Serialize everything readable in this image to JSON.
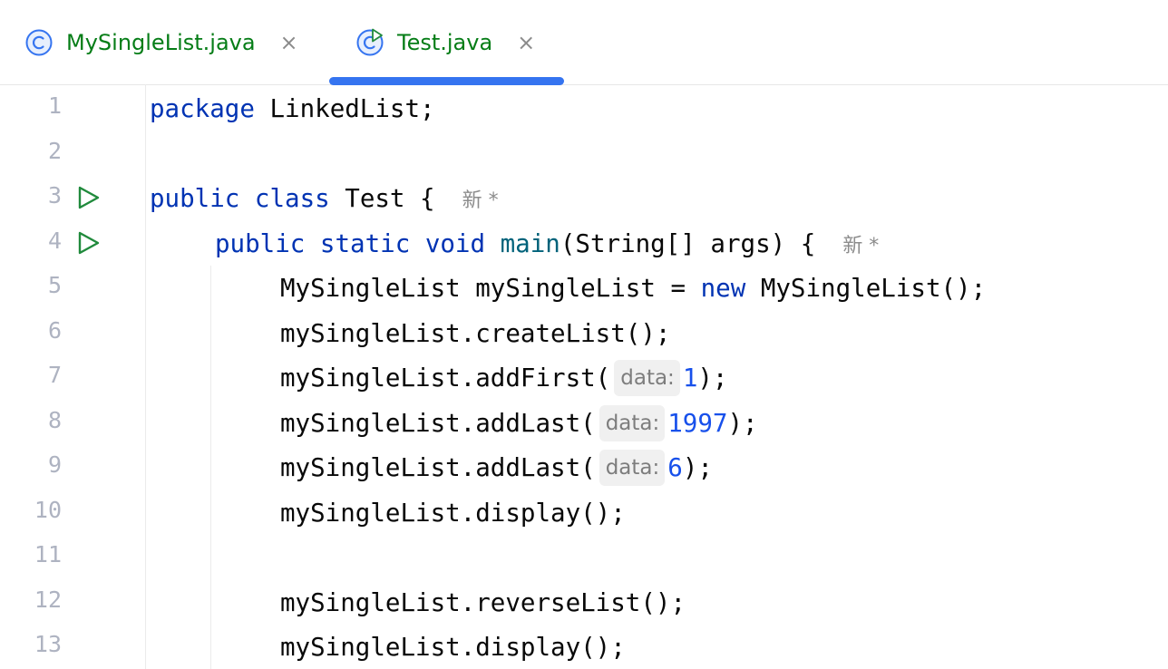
{
  "tabs": [
    {
      "label": "MySingleList.java",
      "icon": "class-icon",
      "close": "×",
      "active": false
    },
    {
      "label": "Test.java",
      "icon": "runnable-class-icon",
      "close": "×",
      "active": true
    }
  ],
  "colors": {
    "accent": "#3574f0",
    "keyword": "#0033b3",
    "method_decl": "#00627a",
    "number": "#1750eb",
    "filename": "#067d17",
    "run_icon": "#208a3c"
  },
  "line_numbers": [
    "1",
    "2",
    "3",
    "4",
    "5",
    "6",
    "7",
    "8",
    "9",
    "10",
    "11",
    "12",
    "13"
  ],
  "code": {
    "l1": {
      "kw": "package",
      "rest": " LinkedList;"
    },
    "l3": {
      "kw1": "public",
      "kw2": "class",
      "rest": " Test {",
      "author": "新 *"
    },
    "l4": {
      "kw1": "public",
      "kw2": "static",
      "kw3": "void",
      "method": "main",
      "rest": "(String[] args) {",
      "author": "新 *"
    },
    "l5": {
      "pre": "MySingleList mySingleList = ",
      "kw": "new",
      "post": " MySingleList();"
    },
    "l6": {
      "text": "mySingleList.createList();"
    },
    "l7": {
      "pre": "mySingleList.addFirst(",
      "hint": "data:",
      "num": "1",
      "post": ");"
    },
    "l8": {
      "pre": "mySingleList.addLast(",
      "hint": "data:",
      "num": "1997",
      "post": ");"
    },
    "l9": {
      "pre": "mySingleList.addLast(",
      "hint": "data:",
      "num": "6",
      "post": ");"
    },
    "l10": {
      "text": "mySingleList.display();"
    },
    "l12": {
      "text": "mySingleList.reverseList();"
    },
    "l13": {
      "text": "mySingleList.display();"
    }
  }
}
